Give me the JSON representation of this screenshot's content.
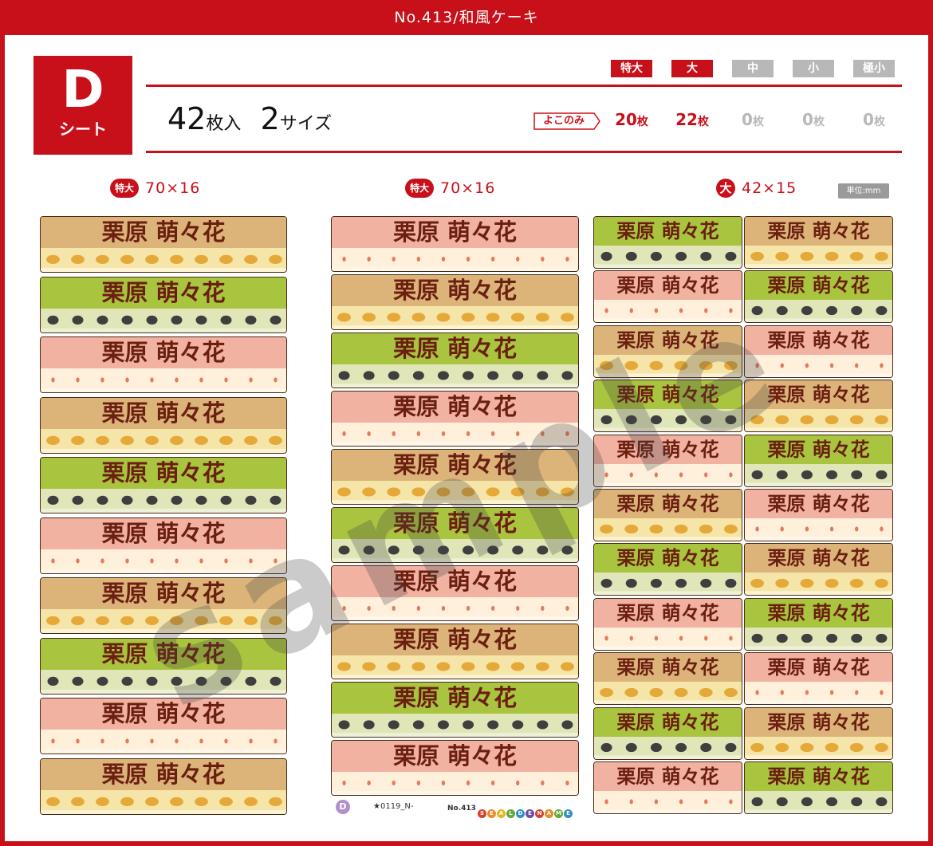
{
  "header": {
    "title": "No.413/和風ケーキ"
  },
  "sheet": {
    "letter": "D",
    "word": "シート"
  },
  "summary": {
    "count": "42",
    "count_unit": "枚入",
    "sizes": "2",
    "sizes_unit": "サイズ"
  },
  "size_tags": [
    {
      "label": "特大",
      "active": true
    },
    {
      "label": "大",
      "active": true
    },
    {
      "label": "中",
      "active": false
    },
    {
      "label": "小",
      "active": false
    },
    {
      "label": "極小",
      "active": false
    }
  ],
  "yoko_label": "よこのみ",
  "counts": [
    {
      "value": "20",
      "unit": "枚",
      "active": true
    },
    {
      "value": "22",
      "unit": "枚",
      "active": true
    },
    {
      "value": "0",
      "unit": "枚",
      "active": false
    },
    {
      "value": "0",
      "unit": "枚",
      "active": false
    },
    {
      "value": "0",
      "unit": "枚",
      "active": false
    }
  ],
  "columns": [
    {
      "tag": "特大",
      "dims": "70×16"
    },
    {
      "tag": "特大",
      "dims": "70×16"
    },
    {
      "tag": "大",
      "dims": "42×15"
    }
  ],
  "unit_label": "単位:mm",
  "label_name": "栗原 萌々花",
  "watermark": "sample",
  "footer": {
    "badge": "D",
    "code": "★0119_N-",
    "number": "No.413",
    "brand_letters": [
      "S",
      "E",
      "A",
      "L",
      "D",
      "E",
      "N",
      "A",
      "M",
      "E"
    ]
  },
  "themes": {
    "chestnut": {
      "top": "#dcb47a",
      "band": "#f6e5a8",
      "dot": "#e5a93a",
      "line": "#fbf3d2"
    },
    "matcha": {
      "top": "#a9c43f",
      "band": "#e0e6b8",
      "dot": "#3f3f3f",
      "line": "#eef1d6"
    },
    "sakura": {
      "top": "#f2b2a2",
      "band": "#fff0dc",
      "dot": "#e47a5c",
      "line": "#fff7ea"
    }
  },
  "col1_themes": [
    "chestnut",
    "matcha",
    "sakura",
    "chestnut",
    "matcha",
    "sakura",
    "chestnut",
    "matcha",
    "sakura",
    "chestnut"
  ],
  "col2_themes": [
    "sakura",
    "chestnut",
    "matcha",
    "sakura",
    "chestnut",
    "matcha",
    "sakura",
    "chestnut",
    "matcha",
    "sakura"
  ],
  "col3_themes": [
    "matcha",
    "sakura",
    "chestnut",
    "matcha",
    "sakura",
    "chestnut",
    "matcha",
    "sakura",
    "chestnut",
    "matcha",
    "sakura"
  ],
  "col4_themes": [
    "chestnut",
    "matcha",
    "sakura",
    "chestnut",
    "matcha",
    "sakura",
    "chestnut",
    "matcha",
    "sakura",
    "chestnut",
    "matcha"
  ]
}
